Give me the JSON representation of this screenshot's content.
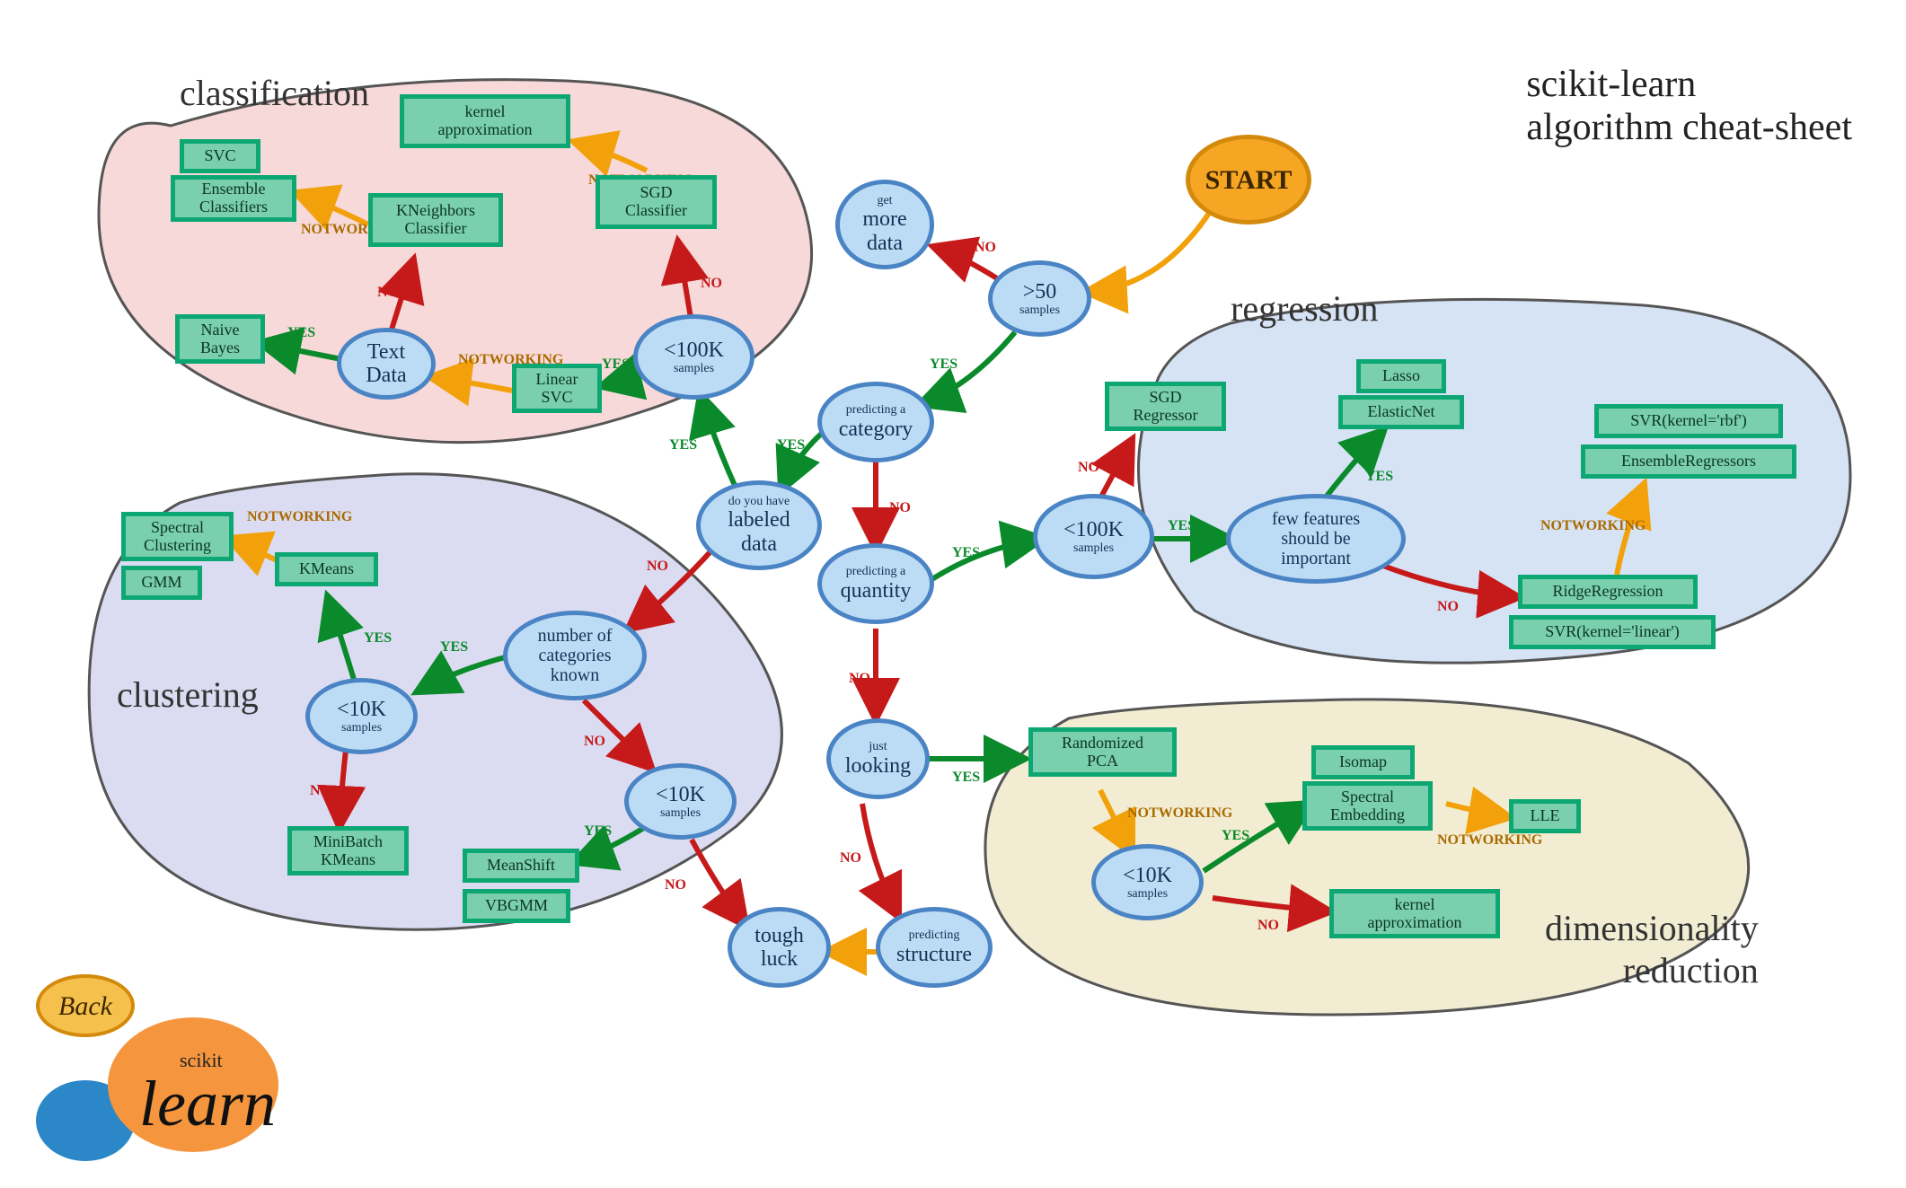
{
  "title_l1": "scikit-learn",
  "title_l2": "algorithm cheat-sheet",
  "headings": {
    "classification": "classification",
    "regression": "regression",
    "clustering": "clustering",
    "dimred_l1": "dimensionality",
    "dimred_l2": "reduction"
  },
  "start": "START",
  "back": "Back",
  "dec": {
    "gt50": {
      "big": ">50",
      "small": "samples"
    },
    "moredata": {
      "small": "get",
      "big": "more",
      "big2": "data"
    },
    "category": {
      "small": "predicting a",
      "big": "category"
    },
    "labeled": {
      "small": "do you have",
      "big": "labeled",
      "big2": "data"
    },
    "lt100k_c": {
      "big": "<100K",
      "small": "samples"
    },
    "textdata": {
      "big": "Text",
      "big2": "Data"
    },
    "quantity": {
      "small": "predicting a",
      "big": "quantity"
    },
    "lt100k_r": {
      "big": "<100K",
      "small": "samples"
    },
    "fewfeat": {
      "line1": "few features",
      "line2": "should be",
      "line3": "important"
    },
    "looking": {
      "small": "just",
      "big": "looking"
    },
    "structure": {
      "small": "predicting",
      "big": "structure"
    },
    "tough": {
      "big": "tough",
      "big2": "luck"
    },
    "numcat": {
      "line1": "number of",
      "line2": "categories",
      "line3": "known"
    },
    "lt10k_cl1": {
      "big": "<10K",
      "small": "samples"
    },
    "lt10k_cl2": {
      "big": "<10K",
      "small": "samples"
    },
    "lt10k_dr": {
      "big": "<10K",
      "small": "samples"
    }
  },
  "algo": {
    "svc": "SVC",
    "ensclf": "Ensemble\nClassifiers",
    "knc": "KNeighbors\nClassifier",
    "kapprox": "kernel\napproximation",
    "sgdclf": "SGD\nClassifier",
    "linsvc": "Linear\nSVC",
    "nb": "Naive\nBayes",
    "kmeans": "KMeans",
    "spec": "Spectral\nClustering",
    "gmm": "GMM",
    "mbk": "MiniBatch\nKMeans",
    "ms": "MeanShift",
    "vbgmm": "VBGMM",
    "sgdr": "SGD\nRegressor",
    "lasso": "Lasso",
    "enet": "ElasticNet",
    "svrrbf": "SVR(kernel='rbf')",
    "ensreg": "EnsembleRegressors",
    "ridge": "RidgeRegression",
    "svrlin": "SVR(kernel='linear')",
    "rpca": "Randomized\nPCA",
    "isomap": "Isomap",
    "specemb": "Spectral\nEmbedding",
    "lle": "LLE",
    "kapprox2": "kernel\napproximation"
  },
  "edgeLabels": {
    "start_gt50": "",
    "gt50_more": "NO",
    "gt50_cat": "YES",
    "cat_lab": "YES",
    "cat_quant": "NO",
    "lab_100k": "YES",
    "lab_numcat": "NO",
    "c100_lin": "YES",
    "c100_sgd": "NO",
    "lin_txt": "NOT\nWORKING",
    "txt_nb": "YES",
    "txt_knc": "NO",
    "knc_ens": "NOT\nWORKING",
    "sgd_kap": "NOT\nWORKING",
    "quant_100r": "YES",
    "quant_look": "NO",
    "r100_sgdr": "NO",
    "r100_few": "YES",
    "few_lasso": "YES",
    "few_ridge": "NO",
    "ridge_svrrbf": "NOT\nWORKING",
    "look_rpca": "YES",
    "look_struct": "NO",
    "struct_tough": "",
    "rpca_10dr": "NOT\nWORKING",
    "dr10_iso": "YES",
    "dr10_kap": "NO",
    "iso_lle": "NOT\nWORKING",
    "numcat_10a": "YES",
    "numcat_10b": "NO",
    "cl10a_km": "YES",
    "cl10a_mbk": "NO",
    "km_spec": "NOT\nWORKING",
    "cl10b_ms": "YES",
    "cl10b_tough": "NO"
  },
  "logo": {
    "scikit": "scikit",
    "learn": "learn"
  }
}
